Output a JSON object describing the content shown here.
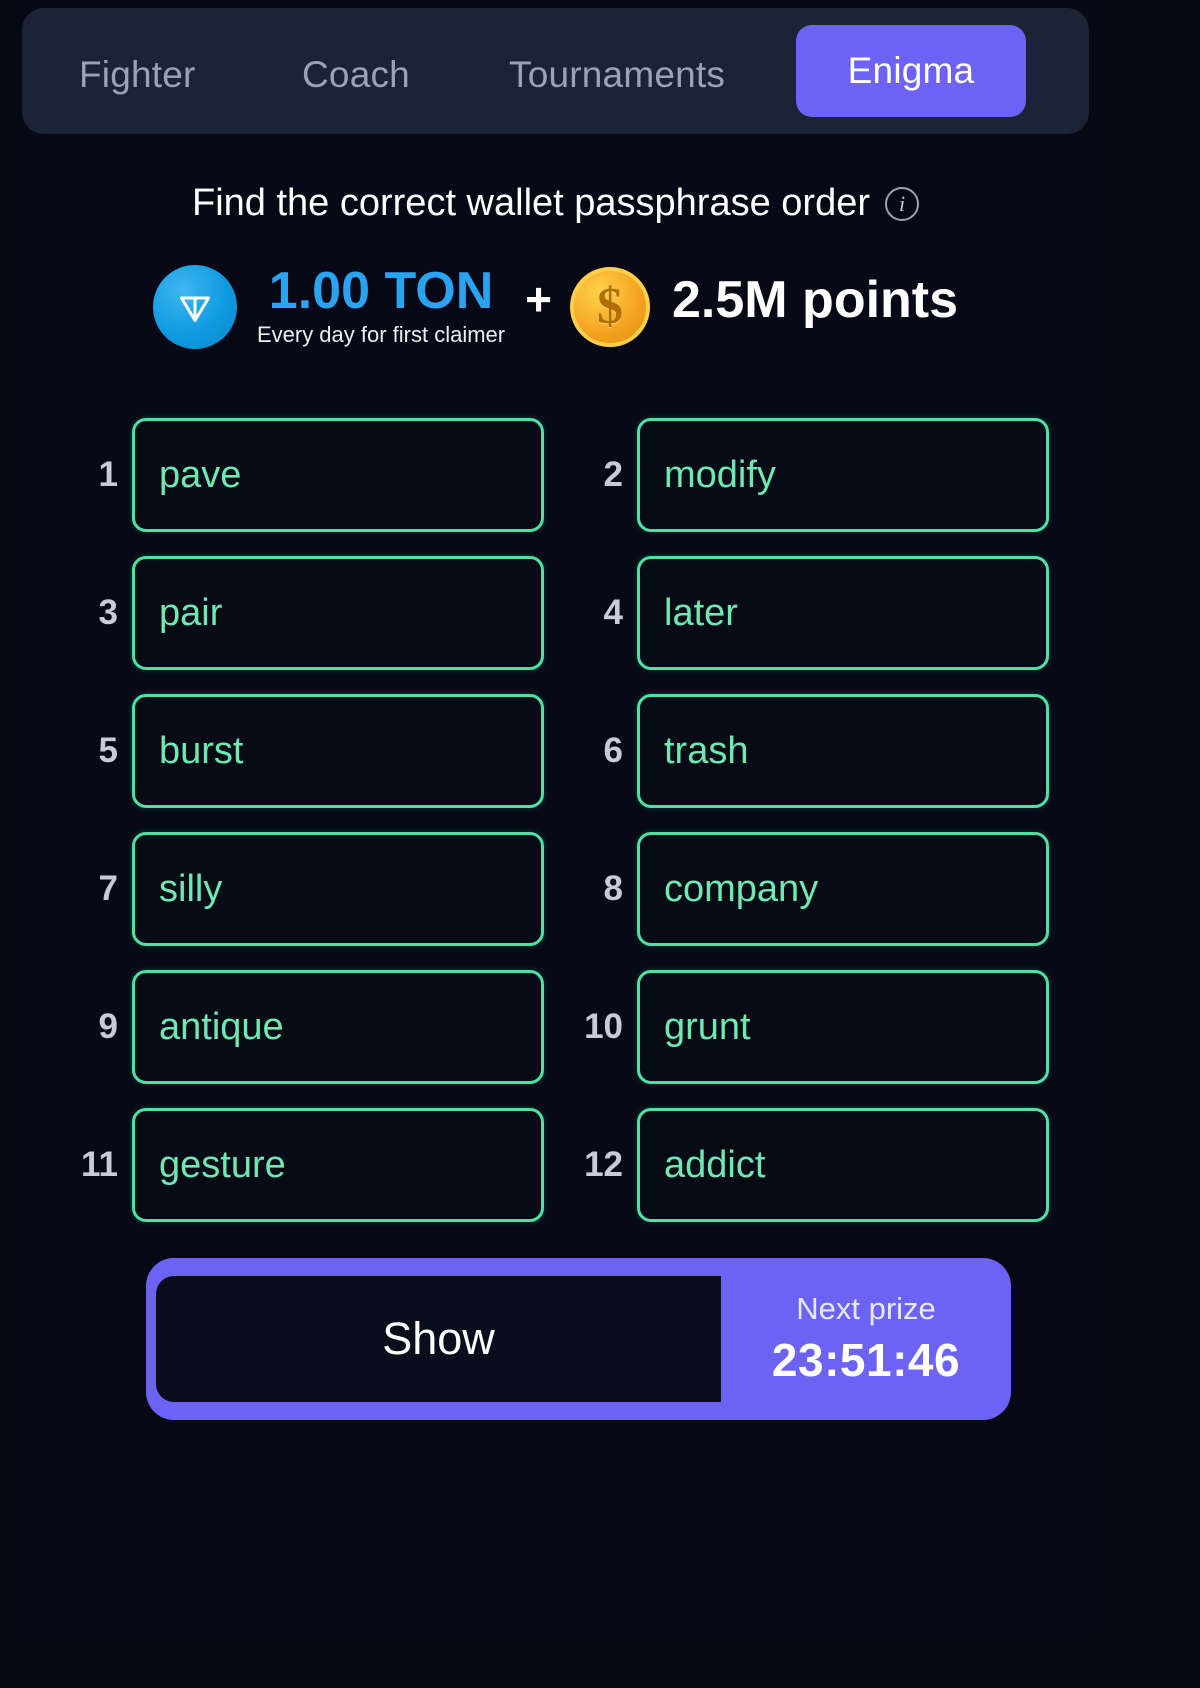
{
  "tabs": [
    {
      "label": "Fighter",
      "active": false
    },
    {
      "label": "Coach",
      "active": false
    },
    {
      "label": "Tournaments",
      "active": false
    },
    {
      "label": "Enigma",
      "active": true
    }
  ],
  "header": {
    "title": "Find the correct wallet passphrase order",
    "info_icon": "info-icon"
  },
  "prize": {
    "ton_icon": "ton-coin-icon",
    "ton_amount": "1.00 TON",
    "ton_note": "Every day for first claimer",
    "separator": "+",
    "coin_icon": "dollar-coin-icon",
    "points": "2.5M points"
  },
  "passphrase": {
    "words": [
      {
        "index": "1",
        "word": "pave"
      },
      {
        "index": "2",
        "word": "modify"
      },
      {
        "index": "3",
        "word": "pair"
      },
      {
        "index": "4",
        "word": "later"
      },
      {
        "index": "5",
        "word": "burst"
      },
      {
        "index": "6",
        "word": "trash"
      },
      {
        "index": "7",
        "word": "silly"
      },
      {
        "index": "8",
        "word": "company"
      },
      {
        "index": "9",
        "word": "antique"
      },
      {
        "index": "10",
        "word": "grunt"
      },
      {
        "index": "11",
        "word": "gesture"
      },
      {
        "index": "12",
        "word": "addict"
      }
    ]
  },
  "actions": {
    "show_label": "Show",
    "next_prize_label": "Next prize",
    "next_prize_timer": "23:51:46"
  },
  "colors": {
    "accent_purple": "#6c63f5",
    "word_green": "#6fe8b2",
    "border_green": "#4fe0a4",
    "ton_blue": "#2aa3f0",
    "coin_gold": "#f5a623",
    "background": "#070a16",
    "tabbar_bg": "#1b2334"
  }
}
